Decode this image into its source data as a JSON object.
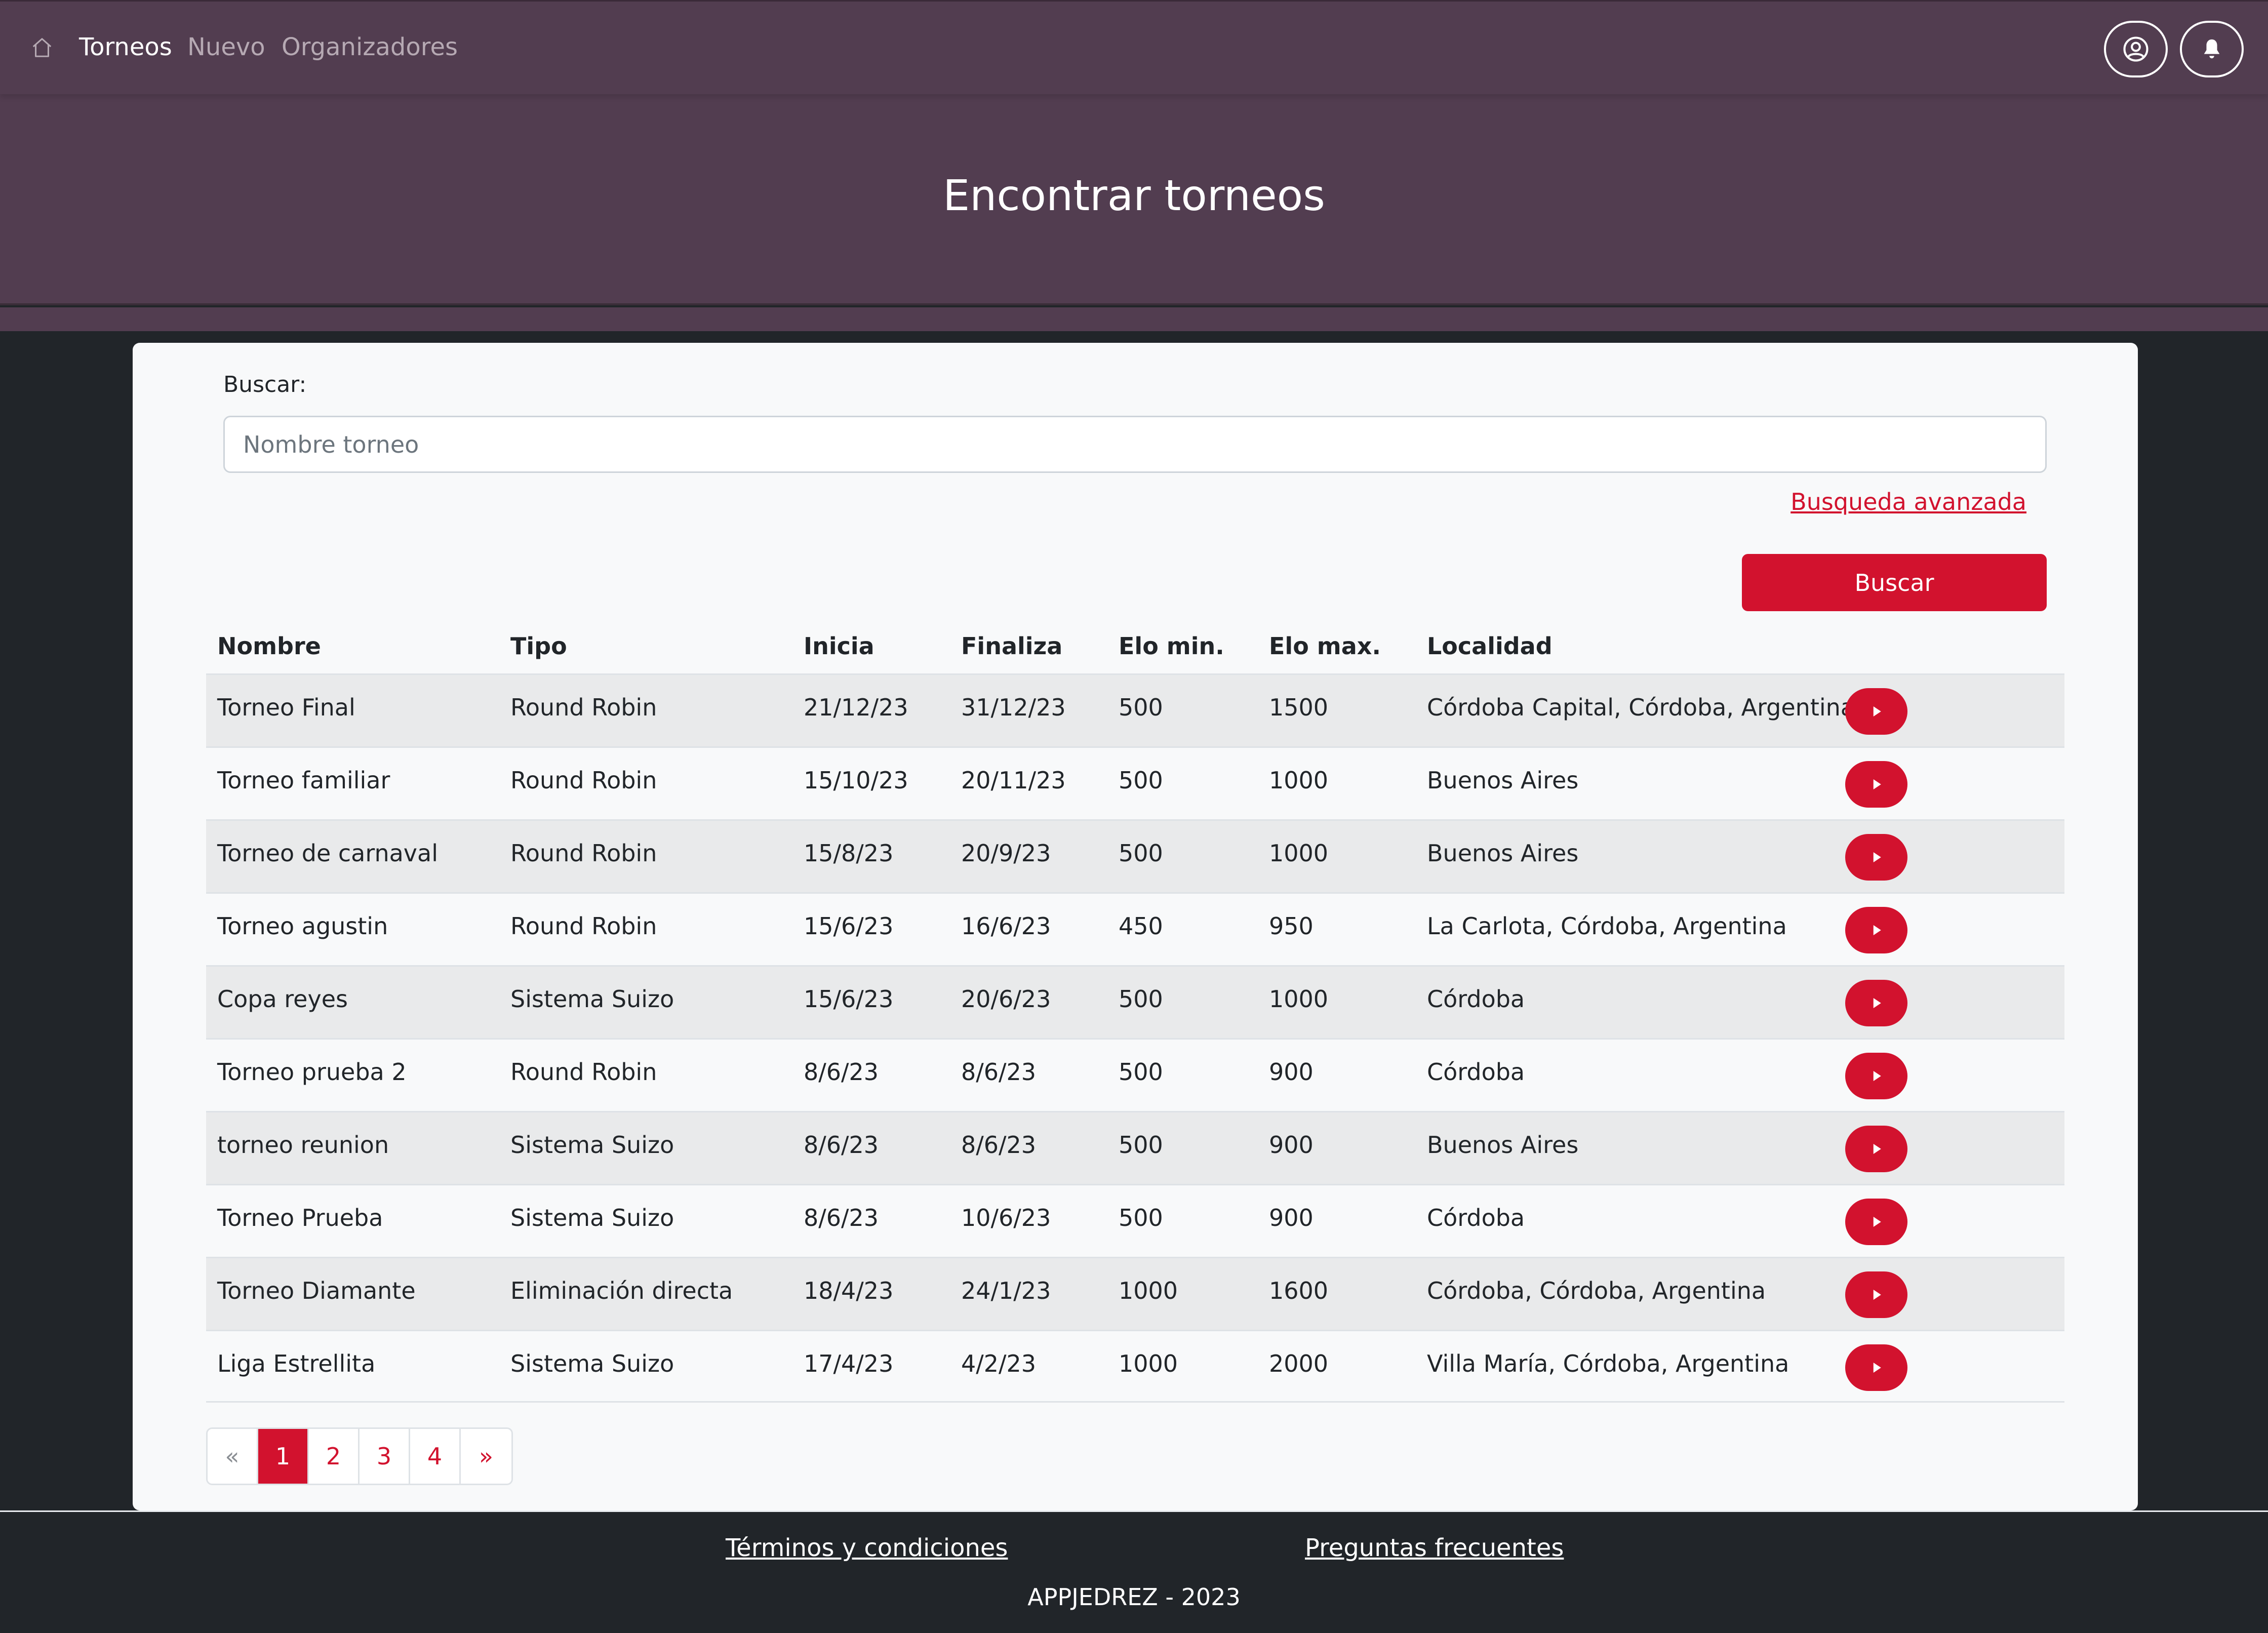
{
  "nav": {
    "home_icon": "home-icon",
    "links": [
      {
        "label": "Torneos",
        "active": true
      },
      {
        "label": "Nuevo",
        "active": false
      },
      {
        "label": "Organizadores",
        "active": false
      }
    ],
    "user_icon": "user-circle-icon",
    "bell_icon": "bell-icon"
  },
  "hero": {
    "title": "Encontrar torneos"
  },
  "search": {
    "label": "Buscar:",
    "placeholder": "Nombre torneo",
    "value": "",
    "advanced_link": "Busqueda avanzada",
    "button_label": "Buscar"
  },
  "table": {
    "headers": [
      "Nombre",
      "Tipo",
      "Inicia",
      "Finaliza",
      "Elo min.",
      "Elo max.",
      "Localidad"
    ],
    "rows": [
      {
        "nombre": "Torneo Final",
        "tipo": "Round Robin",
        "inicia": "21/12/23",
        "finaliza": "31/12/23",
        "elo_min": "500",
        "elo_max": "1500",
        "localidad": "Córdoba Capital, Córdoba, Argentina"
      },
      {
        "nombre": "Torneo familiar",
        "tipo": "Round Robin",
        "inicia": "15/10/23",
        "finaliza": "20/11/23",
        "elo_min": "500",
        "elo_max": "1000",
        "localidad": "Buenos Aires"
      },
      {
        "nombre": "Torneo de carnaval",
        "tipo": "Round Robin",
        "inicia": "15/8/23",
        "finaliza": "20/9/23",
        "elo_min": "500",
        "elo_max": "1000",
        "localidad": "Buenos Aires"
      },
      {
        "nombre": "Torneo agustin",
        "tipo": "Round Robin",
        "inicia": "15/6/23",
        "finaliza": "16/6/23",
        "elo_min": "450",
        "elo_max": "950",
        "localidad": "La Carlota, Córdoba, Argentina"
      },
      {
        "nombre": "Copa reyes",
        "tipo": "Sistema Suizo",
        "inicia": "15/6/23",
        "finaliza": "20/6/23",
        "elo_min": "500",
        "elo_max": "1000",
        "localidad": "Córdoba"
      },
      {
        "nombre": "Torneo prueba 2",
        "tipo": "Round Robin",
        "inicia": "8/6/23",
        "finaliza": "8/6/23",
        "elo_min": "500",
        "elo_max": "900",
        "localidad": "Córdoba"
      },
      {
        "nombre": "torneo reunion",
        "tipo": "Sistema Suizo",
        "inicia": "8/6/23",
        "finaliza": "8/6/23",
        "elo_min": "500",
        "elo_max": "900",
        "localidad": "Buenos Aires"
      },
      {
        "nombre": "Torneo Prueba",
        "tipo": "Sistema Suizo",
        "inicia": "8/6/23",
        "finaliza": "10/6/23",
        "elo_min": "500",
        "elo_max": "900",
        "localidad": "Córdoba"
      },
      {
        "nombre": "Torneo Diamante",
        "tipo": "Eliminación directa",
        "inicia": "18/4/23",
        "finaliza": "24/1/23",
        "elo_min": "1000",
        "elo_max": "1600",
        "localidad": "Córdoba, Córdoba, Argentina"
      },
      {
        "nombre": "Liga Estrellita",
        "tipo": "Sistema Suizo",
        "inicia": "17/4/23",
        "finaliza": "4/2/23",
        "elo_min": "1000",
        "elo_max": "2000",
        "localidad": "Villa María, Córdoba, Argentina"
      }
    ],
    "row_action_icon": "play-icon"
  },
  "pagination": {
    "prev": "«",
    "pages": [
      "1",
      "2",
      "3",
      "4"
    ],
    "active_page": "1",
    "next": "»"
  },
  "footer": {
    "terms_link": "Términos y condiciones",
    "faq_link": "Preguntas frecuentes",
    "copyright": "APPJEDREZ - 2023"
  },
  "colors": {
    "header_bg": "#523d50",
    "accent": "#d2122e",
    "page_bg": "#212529",
    "card_bg": "#f8f9fa"
  }
}
